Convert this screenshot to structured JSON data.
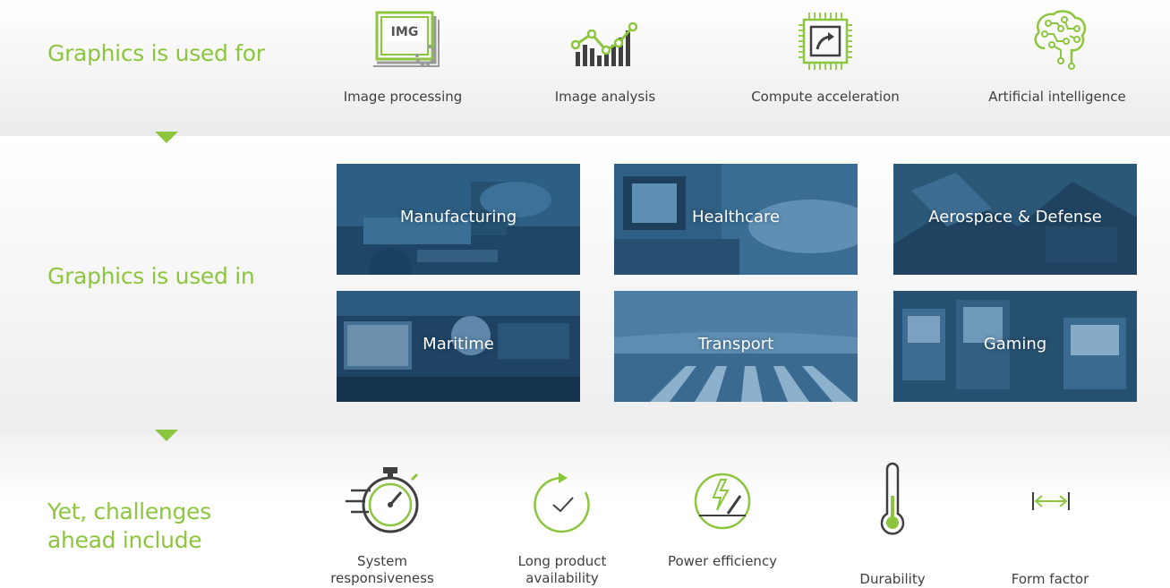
{
  "colors": {
    "accent": "#8cc63f",
    "text": "#3f3f3f",
    "tile_overlay": "#2b5a7e"
  },
  "rows": {
    "uses": {
      "title": "Graphics is used for",
      "items": [
        {
          "label": "Image processing",
          "icon": "image-processing-icon",
          "badge": "IMG"
        },
        {
          "label": "Image analysis",
          "icon": "chart-growth-icon"
        },
        {
          "label": "Compute acceleration",
          "icon": "chip-icon"
        },
        {
          "label": "Artificial intelligence",
          "icon": "brain-circuit-icon"
        }
      ]
    },
    "industries": {
      "title": "Graphics is used in",
      "items": [
        {
          "label": "Manufacturing"
        },
        {
          "label": "Healthcare"
        },
        {
          "label": "Aerospace & Defense"
        },
        {
          "label": "Maritime"
        },
        {
          "label": "Transport"
        },
        {
          "label": "Gaming"
        }
      ]
    },
    "challenges": {
      "title": "Yet, challenges ahead include",
      "items": [
        {
          "label": "System responsiveness",
          "icon": "stopwatch-icon"
        },
        {
          "label": "Long product availability",
          "icon": "refresh-check-icon"
        },
        {
          "label": "Power efficiency",
          "icon": "power-gauge-icon"
        },
        {
          "label": "Durability",
          "icon": "thermometer-icon"
        },
        {
          "label": "Form factor",
          "icon": "width-arrows-icon"
        }
      ]
    }
  }
}
